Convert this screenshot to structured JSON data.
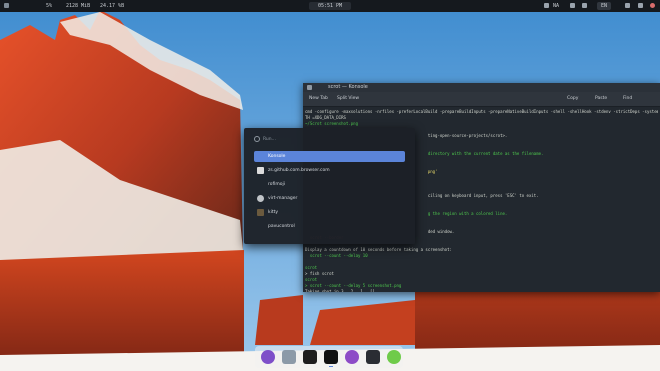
{
  "colors": {
    "topbar": "#15191e",
    "accent": "#5b84d9",
    "terminal_bg": "#22282f",
    "prompt_green": "#4ec94e"
  },
  "topbar": {
    "left": [
      "5%",
      "2128 MiB",
      "24.17 %B"
    ],
    "clock": "05:51 PM",
    "battery": "NA",
    "lang": "EN",
    "icons": [
      "network-icon",
      "battery-icon",
      "keyboard-icon",
      "notification-icon",
      "power-icon"
    ]
  },
  "konsole": {
    "title": "scrot — Konsole",
    "toolbar": [
      "New Tab",
      "Split View",
      "Copy",
      "Paste",
      "Find"
    ],
    "lines": [
      {
        "c": "w",
        "t": "cmd -configure -maxsolutions -nrfiles -preferLocalBuild -prepareBuildInputs -prepareNativeBuildInputs -shell -shellHook -stdenv -strictDeps -system -"
      },
      {
        "c": "w",
        "t": "TH =XDG_DATA_DIRS"
      },
      {
        "c": "g",
        "t": "~/Scrot screenshot.png"
      },
      {
        "c": "w",
        "t": ""
      },
      {
        "c": "w",
        "t": "                                                   ting-open-source-projects/scrot>."
      },
      {
        "c": "w",
        "t": ""
      },
      {
        "c": "w",
        "t": ""
      },
      {
        "c": "g",
        "t": "                                                   directory with the current date as the filename."
      },
      {
        "c": "w",
        "t": ""
      },
      {
        "c": "w",
        "t": ""
      },
      {
        "c": "y",
        "t": "                                                   png'"
      },
      {
        "c": "w",
        "t": ""
      },
      {
        "c": "w",
        "t": ""
      },
      {
        "c": "w",
        "t": ""
      },
      {
        "c": "w",
        "t": "                                                   ciling on keyboard input, press 'ESC' to exit."
      },
      {
        "c": "w",
        "t": ""
      },
      {
        "c": "w",
        "t": ""
      },
      {
        "c": "g",
        "t": "                                                   g the region with a colored line."
      },
      {
        "c": "w",
        "t": ""
      },
      {
        "c": "w",
        "t": ""
      },
      {
        "c": "w",
        "t": "                                                   ded window."
      },
      {
        "c": "r",
        "t": "  scrot --border"
      },
      {
        "c": "w",
        "t": ""
      },
      {
        "c": "w",
        "t": "Display a countdown of 10 seconds before taking a screenshot:"
      },
      {
        "c": "g",
        "t": "  scrot --count --delay 10"
      },
      {
        "c": "w",
        "t": ""
      },
      {
        "c": "g",
        "t": "scrot"
      },
      {
        "c": "w",
        "t": "> fish scrot"
      },
      {
        "c": "g",
        "t": "scrot"
      },
      {
        "c": "g",
        "t": "> scrot --count --delay 5 screenshot.png"
      },
      {
        "c": "w",
        "t": "Taking shot in 3.. 2.. 1.. []"
      }
    ]
  },
  "launcher": {
    "search_placeholder": "Run...",
    "items": [
      {
        "label": "Konsole",
        "icon": "konsole-icon",
        "color": "#4a5663"
      },
      {
        "label": "zs.github.com.browser.com",
        "icon": "zen-browser-icon",
        "color": "#dcdcdc"
      },
      {
        "label": "rofimoji",
        "icon": "rofimoji-icon",
        "color": "#3a3f46"
      },
      {
        "label": "virt-manager",
        "icon": "virt-manager-icon",
        "color": "#c0c4c8"
      },
      {
        "label": "kitty",
        "icon": "kitty-icon",
        "color": "#6b5a3e"
      },
      {
        "label": "pavucontrol",
        "icon": "pavucontrol-icon",
        "color": "#3a3f46"
      }
    ]
  },
  "dock": {
    "items": [
      {
        "icon": "emacs-icon",
        "color": "#7e4fc9"
      },
      {
        "icon": "file-manager-icon",
        "color": "#8c9aa8"
      },
      {
        "icon": "zen-browser-icon",
        "color": "#1e1e1e"
      },
      {
        "icon": "terminal-icon",
        "color": "#111111"
      },
      {
        "icon": "obs-icon",
        "color": "#8d4cc7"
      },
      {
        "icon": "code-editor-icon",
        "color": "#2a2d33"
      },
      {
        "icon": "chromium-icon",
        "color": "#6fcb4a"
      }
    ]
  }
}
